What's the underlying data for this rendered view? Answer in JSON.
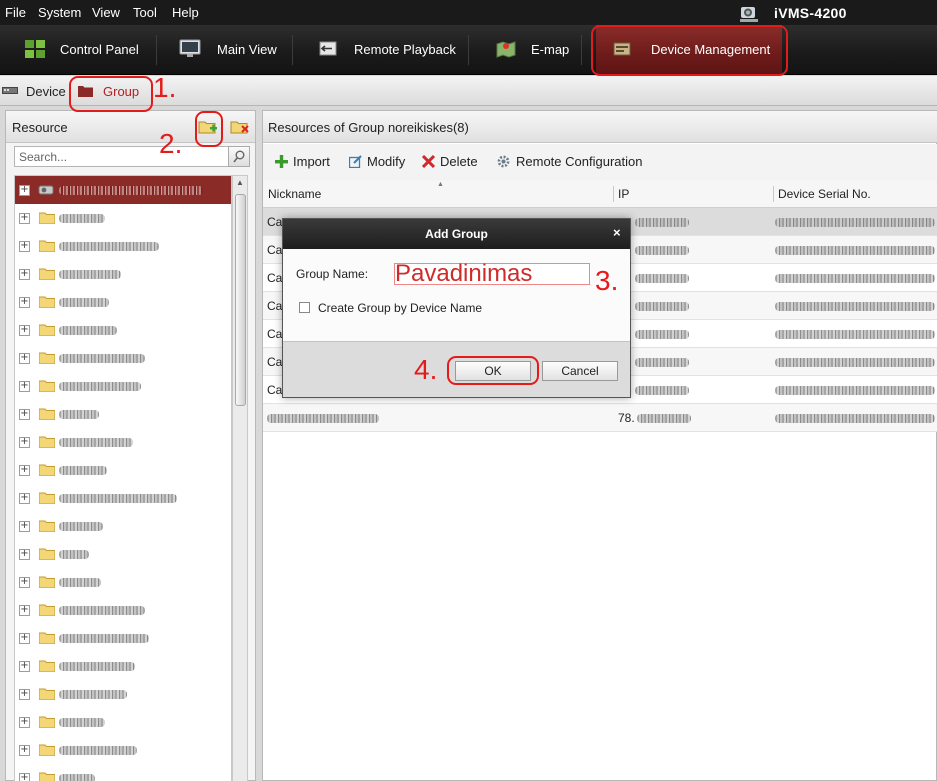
{
  "menubar": {
    "items": [
      "File",
      "System",
      "View",
      "Tool",
      "Help"
    ],
    "app_name": "iVMS-4200",
    "logo_icon": "camera-icon"
  },
  "toolbar": {
    "items": [
      {
        "label": "Control Panel",
        "icon": "grid-icon"
      },
      {
        "label": "Main View",
        "icon": "monitor-icon"
      },
      {
        "label": "Remote Playback",
        "icon": "playback-icon"
      },
      {
        "label": "E-map",
        "icon": "map-icon"
      },
      {
        "label": "Device Management",
        "icon": "device-icon",
        "active": true
      }
    ]
  },
  "subtabs": {
    "device": "Device",
    "group": "Group"
  },
  "resource_panel": {
    "title": "Resource",
    "search_placeholder": "Search..."
  },
  "main": {
    "title": "Resources of Group noreikiskes(8)",
    "actions": {
      "import": "Import",
      "modify": "Modify",
      "delete": "Delete",
      "remote_config": "Remote Configuration"
    },
    "columns": {
      "nickname": "Nickname",
      "ip": "IP",
      "serial": "Device Serial No."
    },
    "rows": [
      {
        "nickname": "Ca",
        "ip": ""
      },
      {
        "nickname": "Ca",
        "ip": ""
      },
      {
        "nickname": "Ca",
        "ip": ""
      },
      {
        "nickname": "Ca",
        "ip": ""
      },
      {
        "nickname": "Ca",
        "ip": ""
      },
      {
        "nickname": "Ca",
        "ip": ""
      },
      {
        "nickname": "Ca",
        "ip": ""
      },
      {
        "nickname": "",
        "ip": "78."
      }
    ]
  },
  "dialog": {
    "title": "Add Group",
    "close": "×",
    "group_name_label": "Group Name:",
    "group_name_value": "Pavadinimas",
    "checkbox_label": "Create Group by Device Name",
    "ok": "OK",
    "cancel": "Cancel"
  },
  "annotations": {
    "n1": "1.",
    "n2": "2.",
    "n3": "3.",
    "n4": "4.",
    "color": "#e41b1b"
  },
  "colors": {
    "accent_dark_red": "#8b2b28",
    "active_text_red": "#b32025"
  }
}
